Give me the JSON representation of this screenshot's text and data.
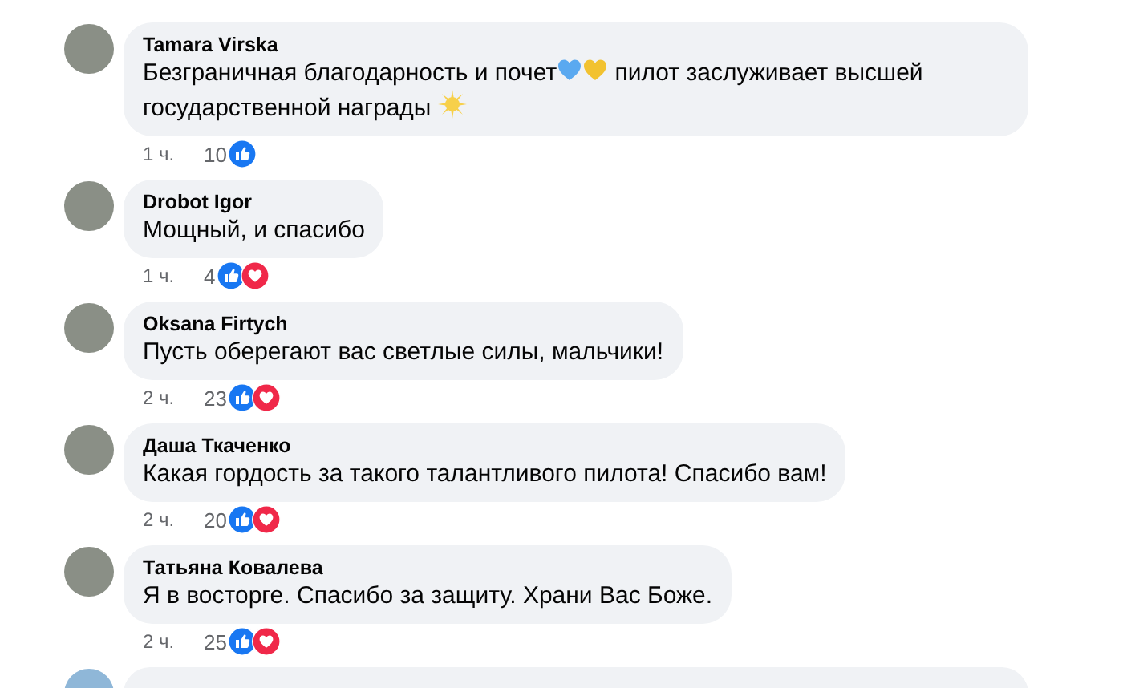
{
  "comments": [
    {
      "author": "Tamara Virska",
      "body": [
        {
          "kind": "text",
          "text": "Безграничная благодарность и почет"
        },
        {
          "kind": "heart",
          "color": "#5aa9f0"
        },
        {
          "kind": "heart",
          "color": "#f2c230"
        },
        {
          "kind": "text",
          "text": " пилот заслуживает высшей государственной награды "
        },
        {
          "kind": "star"
        }
      ],
      "time": "1 ч.",
      "count": "10",
      "reactions": [
        {
          "kind": "like"
        }
      ]
    },
    {
      "author": "Drobot Igor",
      "body": [
        {
          "kind": "text",
          "text": "Мощный, и спасибо"
        }
      ],
      "time": "1 ч.",
      "count": "4",
      "reactions": [
        {
          "kind": "like"
        },
        {
          "kind": "love"
        }
      ]
    },
    {
      "author": "Oksana Firtych",
      "body": [
        {
          "kind": "text",
          "text": "Пусть оберегают вас светлые силы, мальчики!"
        }
      ],
      "time": "2 ч.",
      "count": "23",
      "reactions": [
        {
          "kind": "like"
        },
        {
          "kind": "love"
        }
      ]
    },
    {
      "author": "Даша Ткаченко",
      "body": [
        {
          "kind": "text",
          "text": "Какая гордость за такого талантливого пилота! Спасибо вам!"
        }
      ],
      "time": "2 ч.",
      "count": "20",
      "reactions": [
        {
          "kind": "like"
        },
        {
          "kind": "love"
        }
      ]
    },
    {
      "author": "Татьяна Ковалева",
      "body": [
        {
          "kind": "text",
          "text": "Я в восторге. Спасибо за защиту. Храни Вас Боже."
        }
      ],
      "time": "2 ч.",
      "count": "25",
      "reactions": [
        {
          "kind": "like"
        },
        {
          "kind": "love"
        }
      ]
    }
  ]
}
